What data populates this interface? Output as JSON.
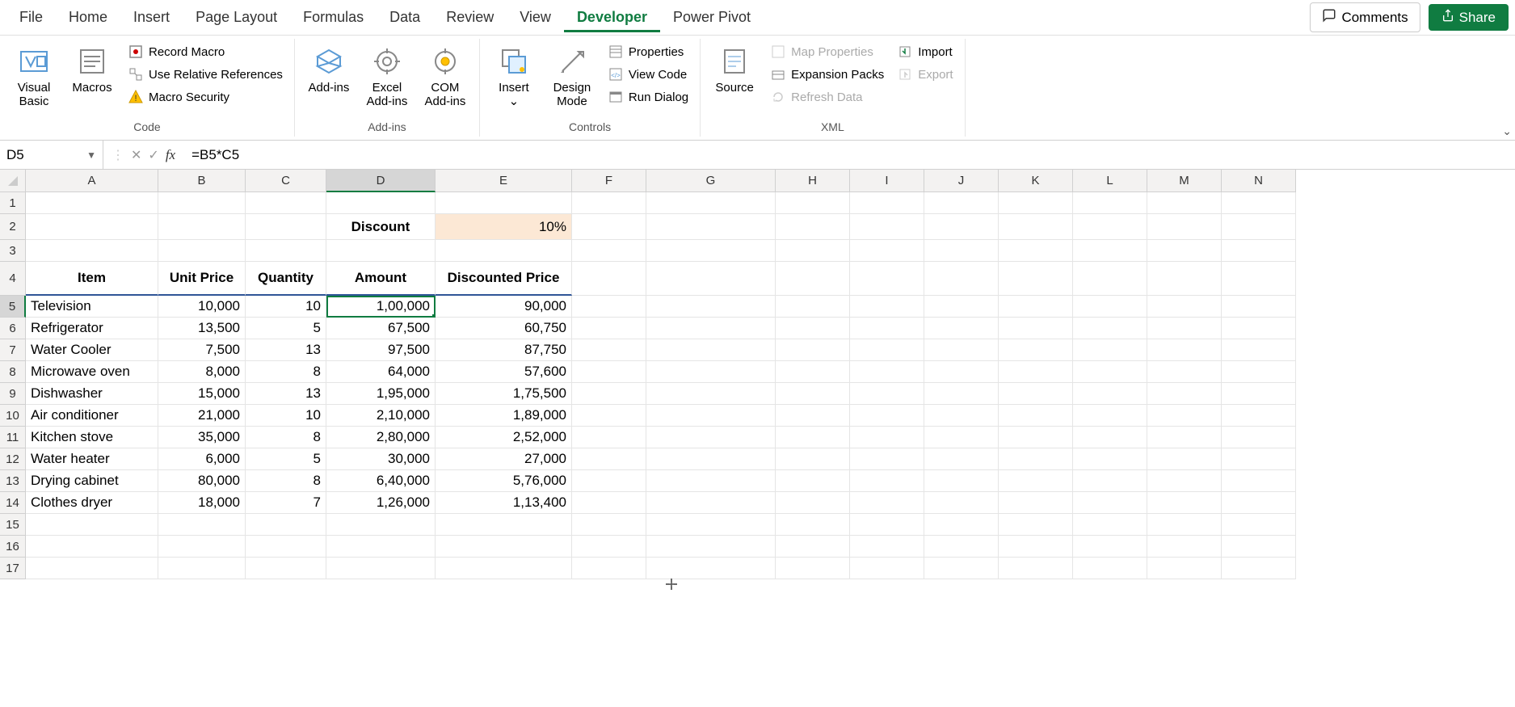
{
  "menu": {
    "items": [
      "File",
      "Home",
      "Insert",
      "Page Layout",
      "Formulas",
      "Data",
      "Review",
      "View",
      "Developer",
      "Power Pivot"
    ],
    "active": "Developer",
    "comments": "Comments",
    "share": "Share"
  },
  "ribbon": {
    "groups": {
      "code": {
        "label": "Code",
        "visual_basic": "Visual Basic",
        "macros": "Macros",
        "record_macro": "Record Macro",
        "use_relative": "Use Relative References",
        "macro_security": "Macro Security"
      },
      "addins": {
        "label": "Add-ins",
        "addins": "Add-ins",
        "excel_addins": "Excel Add-ins",
        "com_addins": "COM Add-ins"
      },
      "controls": {
        "label": "Controls",
        "insert": "Insert",
        "design_mode": "Design Mode",
        "properties": "Properties",
        "view_code": "View Code",
        "run_dialog": "Run Dialog"
      },
      "xml": {
        "label": "XML",
        "source": "Source",
        "map_properties": "Map Properties",
        "expansion_packs": "Expansion Packs",
        "refresh_data": "Refresh Data",
        "import": "Import",
        "export": "Export"
      }
    }
  },
  "formula_bar": {
    "name_box": "D5",
    "formula": "=B5*C5"
  },
  "grid": {
    "columns": [
      "A",
      "B",
      "C",
      "D",
      "E",
      "F",
      "G",
      "H",
      "I",
      "J",
      "K",
      "L",
      "M",
      "N"
    ],
    "selected_col": "D",
    "selected_row": "5",
    "discount_label": "Discount",
    "discount_value": "10%",
    "headers": {
      "item": "Item",
      "unit_price": "Unit Price",
      "quantity": "Quantity",
      "amount": "Amount",
      "discounted": "Discounted Price"
    },
    "rows": [
      {
        "item": "Television",
        "unit_price": "10,000",
        "quantity": "10",
        "amount": "1,00,000",
        "discounted": "90,000"
      },
      {
        "item": "Refrigerator",
        "unit_price": "13,500",
        "quantity": "5",
        "amount": "67,500",
        "discounted": "60,750"
      },
      {
        "item": "Water Cooler",
        "unit_price": "7,500",
        "quantity": "13",
        "amount": "97,500",
        "discounted": "87,750"
      },
      {
        "item": "Microwave oven",
        "unit_price": "8,000",
        "quantity": "8",
        "amount": "64,000",
        "discounted": "57,600"
      },
      {
        "item": "Dishwasher",
        "unit_price": "15,000",
        "quantity": "13",
        "amount": "1,95,000",
        "discounted": "1,75,500"
      },
      {
        "item": "Air conditioner",
        "unit_price": "21,000",
        "quantity": "10",
        "amount": "2,10,000",
        "discounted": "1,89,000"
      },
      {
        "item": "Kitchen stove",
        "unit_price": "35,000",
        "quantity": "8",
        "amount": "2,80,000",
        "discounted": "2,52,000"
      },
      {
        "item": "Water heater",
        "unit_price": "6,000",
        "quantity": "5",
        "amount": "30,000",
        "discounted": "27,000"
      },
      {
        "item": "Drying cabinet",
        "unit_price": "80,000",
        "quantity": "8",
        "amount": "6,40,000",
        "discounted": "5,76,000"
      },
      {
        "item": "Clothes dryer",
        "unit_price": "18,000",
        "quantity": "7",
        "amount": "1,26,000",
        "discounted": "1,13,400"
      }
    ]
  }
}
